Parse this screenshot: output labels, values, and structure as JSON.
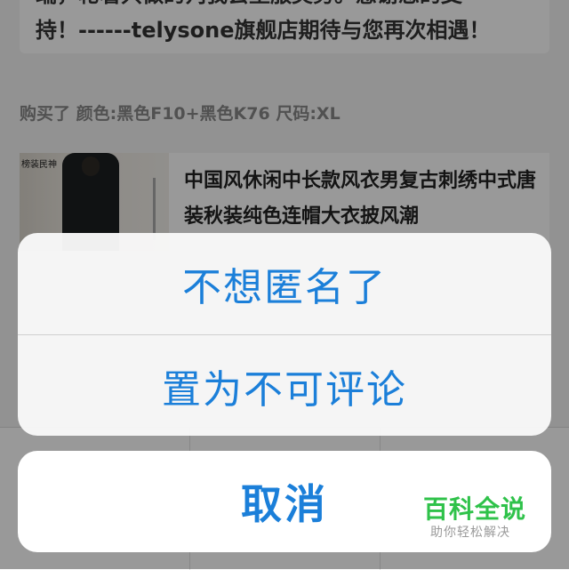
{
  "review": {
    "reply_text": "端，轮着只做的判我会坚服美务。感谢您的支\n持！------telysone旗舰店期待与您再次相遇！"
  },
  "purchase": {
    "info": "购买了 颜色:黑色F10+黑色K76 尺码:XL"
  },
  "product": {
    "thumb_text": "榜装民神",
    "title": "中国风休闲中长款风衣男复古刺绣中式唐装秋装纯色连帽大衣披风潮"
  },
  "action_sheet": {
    "option_1": "不想匿名了",
    "option_2": "置为不可评论",
    "cancel": "取消",
    "accent_color": "#1b7fd9"
  },
  "watermark": {
    "brand": "百科全说",
    "slogan": "助你轻松解决",
    "brand_color": "#2fc24a"
  }
}
